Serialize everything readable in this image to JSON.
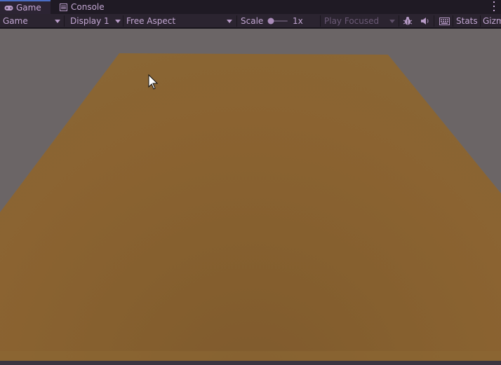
{
  "tabs": [
    {
      "label": "Game",
      "icon": "gamepad-icon",
      "active": true
    },
    {
      "label": "Console",
      "icon": "console-icon",
      "active": false
    }
  ],
  "toolbar": {
    "view_select": "Game",
    "display_select": "Display 1",
    "aspect_select": "Free Aspect",
    "scale_label": "Scale",
    "scale_value": "1x",
    "scale_level": 0,
    "play_mode_select": "Play Focused",
    "stats_label": "Stats",
    "gizmos_label": "Gizm",
    "icons": [
      "bug-icon",
      "speaker-icon",
      "keyboard-icon",
      "kebab-menu-icon"
    ]
  },
  "colors": {
    "sky": "#6b6566",
    "floor": "#8a6231",
    "accent": "#4a6dc4",
    "text": "#c2a6d2"
  }
}
